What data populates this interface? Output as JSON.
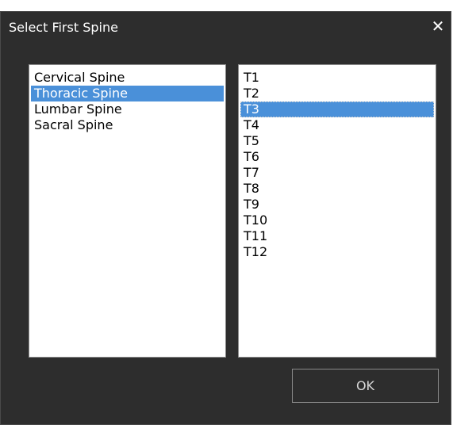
{
  "window": {
    "title": "Select First Spine",
    "close_glyph": "✕"
  },
  "regions": {
    "items": [
      {
        "label": "Cervical Spine",
        "selected": false
      },
      {
        "label": "Thoracic Spine",
        "selected": true
      },
      {
        "label": "Lumbar Spine",
        "selected": false
      },
      {
        "label": "Sacral Spine",
        "selected": false
      }
    ]
  },
  "vertebrae": {
    "items": [
      {
        "label": "T1",
        "selected": false
      },
      {
        "label": "T2",
        "selected": false
      },
      {
        "label": "T3",
        "selected": true
      },
      {
        "label": "T4",
        "selected": false
      },
      {
        "label": "T5",
        "selected": false
      },
      {
        "label": "T6",
        "selected": false
      },
      {
        "label": "T7",
        "selected": false
      },
      {
        "label": "T8",
        "selected": false
      },
      {
        "label": "T9",
        "selected": false
      },
      {
        "label": "T10",
        "selected": false
      },
      {
        "label": "T11",
        "selected": false
      },
      {
        "label": "T12",
        "selected": false
      }
    ]
  },
  "footer": {
    "ok_label": "OK"
  },
  "colors": {
    "window_bg": "#2d2d2d",
    "selection": "#4a90d9",
    "text_light": "#ffffff"
  }
}
